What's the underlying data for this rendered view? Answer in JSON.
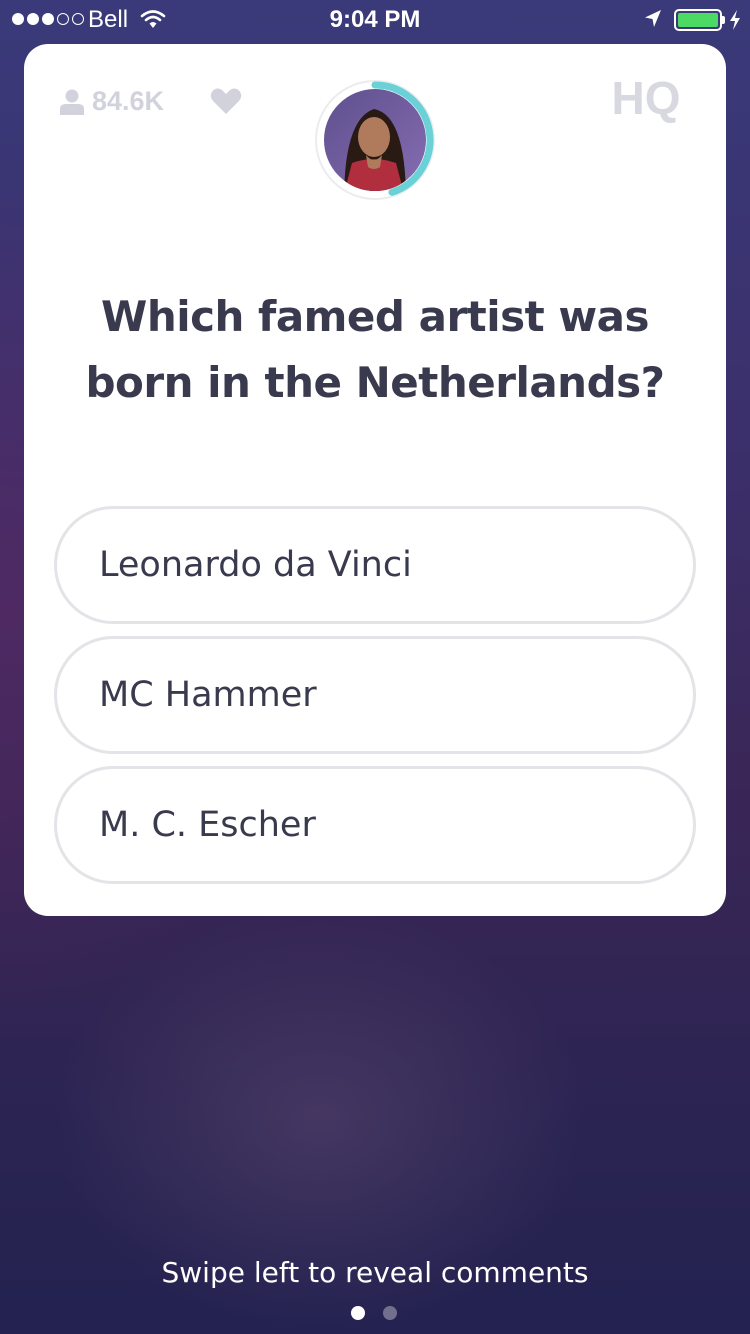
{
  "status_bar": {
    "carrier": "Bell",
    "time": "9:04 PM",
    "signal_bars_filled": 3,
    "signal_bars_total": 5,
    "battery_level": 1.0,
    "battery_color": "#4cd964"
  },
  "header": {
    "viewer_count": "84.6K",
    "logo_text": "HQ"
  },
  "question": {
    "text": "Which famed artist was born in the Netherlands?"
  },
  "answers": [
    {
      "label": "Leonardo da Vinci"
    },
    {
      "label": "MC Hammer"
    },
    {
      "label": "M. C. Escher"
    }
  ],
  "timer": {
    "remaining_fraction": 0.45,
    "color": "#6ad1d6"
  },
  "footer": {
    "swipe_hint": "Swipe left to reveal comments",
    "page_count": 2,
    "active_page": 1
  },
  "icons": [
    "wifi-icon",
    "location-arrow-icon",
    "battery-icon",
    "charging-bolt-icon",
    "person-icon",
    "heart-icon"
  ]
}
